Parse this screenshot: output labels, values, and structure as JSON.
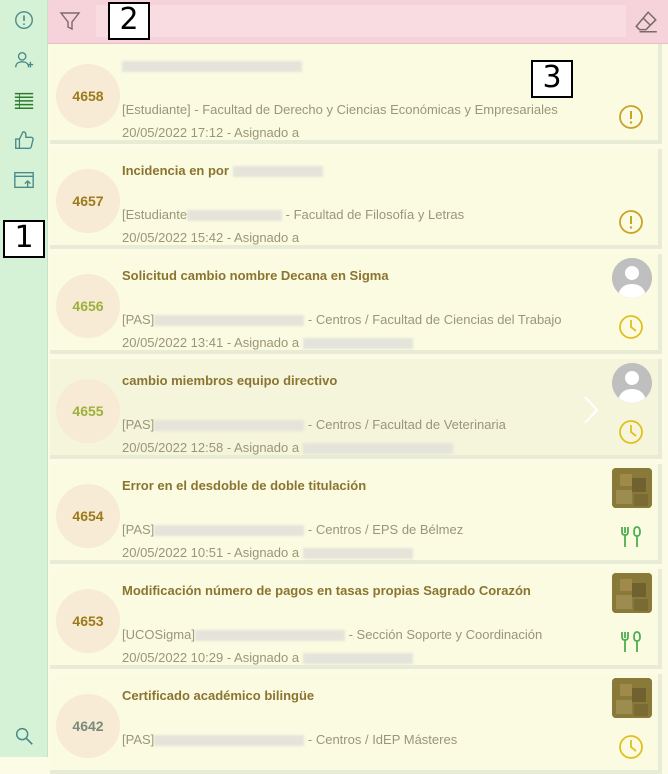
{
  "sidebar": {
    "items": [
      {
        "name": "incidents-icon"
      },
      {
        "name": "add-user-icon"
      },
      {
        "name": "list-icon"
      },
      {
        "name": "thumbs-up-icon"
      },
      {
        "name": "export-icon"
      }
    ],
    "search_icon": "search-icon"
  },
  "topbar": {
    "search_value": "",
    "search_placeholder": ""
  },
  "callouts": [
    "1",
    "2",
    "3"
  ],
  "tickets": [
    {
      "id": "4658",
      "title": "",
      "meta": "[Estudiante] - Facultad de Derecho y Ciencias Económicas y Empresariales",
      "date": "20/05/2022 17:12 - Asignado a",
      "status": "alert",
      "avatar": "none",
      "id_color": "#9c7a1a"
    },
    {
      "id": "4657",
      "title": "Incidencia en por",
      "meta_prefix": "[Estudiante",
      "meta_suffix": " - Facultad de Filosofía y Letras",
      "date": "20/05/2022 15:42 - Asignado a",
      "status": "alert",
      "avatar": "none",
      "id_color": "#9c7a1a"
    },
    {
      "id": "4656",
      "title": "Solicitud cambio nombre Decana en Sigma",
      "meta_prefix": "[PAS]",
      "meta_suffix": " - Centros / Facultad de Ciencias del Trabajo",
      "date": "20/05/2022 13:41 - Asignado a",
      "status": "clock",
      "avatar": "generic",
      "id_color": "#9ab23a"
    },
    {
      "id": "4655",
      "title": "cambio miembros equipo directivo",
      "meta_prefix": "[PAS]",
      "meta_suffix": " - Centros / Facultad de Veterinaria",
      "date": "20/05/2022 12:58 - Asignado a",
      "status": "clock",
      "avatar": "generic",
      "id_color": "#9ab23a"
    },
    {
      "id": "4654",
      "title": "Error en el desdoble de doble titulación",
      "meta_prefix": "[PAS]",
      "meta_suffix": " - Centros / EPS de Bélmez",
      "date": "20/05/2022 10:51 - Asignado a",
      "status": "tools",
      "avatar": "photo",
      "id_color": "#9c7a1a"
    },
    {
      "id": "4653",
      "title": "Modificación número de pagos en tasas propias Sagrado Corazón",
      "meta_prefix": "[UCOSigma]",
      "meta_suffix": " - Sección Soporte y Coordinación",
      "date": "20/05/2022 10:29 - Asignado a",
      "status": "tools",
      "avatar": "photo",
      "id_color": "#9c7a1a"
    },
    {
      "id": "4642",
      "title": "Certificado académico bilingüe",
      "meta_prefix": "[PAS]",
      "meta_suffix": " - Centros / IdEP Másteres",
      "date": "",
      "status": "clock",
      "avatar": "photo",
      "id_color": "#7a8a7a"
    }
  ],
  "colors": {
    "sidebar_bg": "#d6f2d6",
    "topbar_bg": "#f6d3da",
    "card_bg": "#fbfbe2",
    "alert": "#c9a227",
    "clock": "#e0c020",
    "tools": "#4caf50"
  }
}
